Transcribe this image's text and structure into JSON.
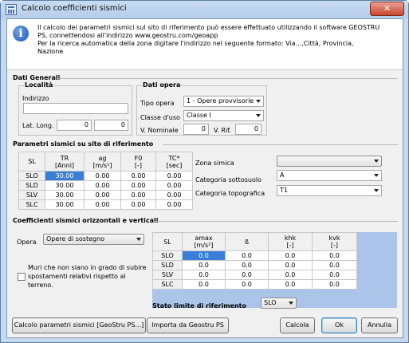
{
  "window": {
    "title": "Calcolo coefficienti sismici",
    "close_label": "✕"
  },
  "info": {
    "text": "Il calcolo dei parametri sismici sul sito di riferimento può essere effettuato utilizzando il software GEOSTRU\nPS, connettendosi all'indirizzo www.geostru.com/geoapp\nPer la ricerca automatica della zona digitare l'indirizzo nel seguente formato: Via...,Città, Provincia,\nNazione"
  },
  "dati_generali": {
    "title": "Dati Generali",
    "localita": {
      "title": "Località",
      "indirizzo_label": "Indirizzo",
      "indirizzo_value": "",
      "latlong_label": "Lat. Long.",
      "lat": "0",
      "long": "0"
    },
    "dati_opera": {
      "title": "Dati opera",
      "tipo_opera_label": "Tipo opera",
      "tipo_opera_value": "1 - Opere provvisorie",
      "classe_uso_label": "Classe d'uso",
      "classe_uso_value": "Classe I",
      "v_nominale_label": "V. Nominale",
      "v_nominale_value": "0",
      "v_rif_label": "V. Rif.",
      "v_rif_value": "0"
    }
  },
  "parametri": {
    "title": "Parametri sismici su sito di riferimento",
    "headers": [
      "SL",
      "TR\n[Anni]",
      "ag\n[m/s²]",
      "F0\n[-]",
      "TC*\n[sec]"
    ],
    "rows": [
      [
        "SLO",
        "30.00",
        "0.00",
        "0.00",
        "0.00"
      ],
      [
        "SLD",
        "30.00",
        "0.00",
        "0.00",
        "0.00"
      ],
      [
        "SLV",
        "30.00",
        "0.00",
        "0.00",
        "0.00"
      ],
      [
        "SLC",
        "30.00",
        "0.00",
        "0.00",
        "0.00"
      ]
    ],
    "zona_simica_label": "Zona simica",
    "zona_simica_value": "",
    "cat_sottosuolo_label": "Categoria sottosuolo",
    "cat_sottosuolo_value": "A",
    "cat_topografica_label": "Categoria topografica",
    "cat_topografica_value": "T1"
  },
  "coefficienti": {
    "title": "Coefficienti sismici orizzontali e verticali",
    "opera_label": "Opera",
    "opera_value": "Opere di sostegno",
    "checkbox_label": "Muri che non  siano in grado di subire\nspostamenti relativi rispetto al\nterreno.",
    "checkbox_checked": false,
    "headers": [
      "SL",
      "amax\n[m/s²]",
      "ß",
      "khk\n[-]",
      "kvk\n[-]"
    ],
    "rows": [
      [
        "SLO",
        "0.0",
        "0.0",
        "0.0",
        "0.0"
      ],
      [
        "SLD",
        "0.0",
        "0.0",
        "0.0",
        "0.0"
      ],
      [
        "SLV",
        "0.0",
        "0.0",
        "0.0",
        "0.0"
      ],
      [
        "SLC",
        "0.0",
        "0.0",
        "0.0",
        "0.0"
      ]
    ],
    "stato_limite_label": "Stato limite di riferimento",
    "stato_limite_value": "SLO"
  },
  "buttons": {
    "calcola_ps": "Calcolo parametri sismici [GeoStru PS...]",
    "importa": "Importa da Geostru PS",
    "calcola": "Calcola",
    "ok": "Ok",
    "annulla": "Annulla"
  }
}
